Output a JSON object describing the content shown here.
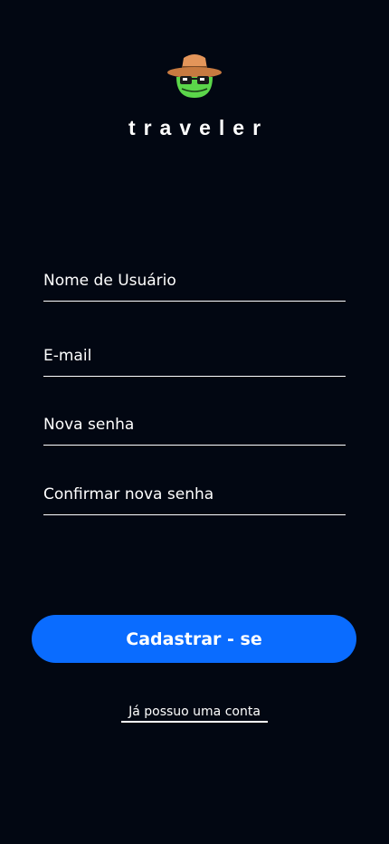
{
  "app": {
    "brand_name": "traveler",
    "logo_icon": "frog-with-hat-icon"
  },
  "form": {
    "username_placeholder": "Nome de Usuário",
    "email_placeholder": "E-mail",
    "new_password_placeholder": "Nova senha",
    "confirm_password_placeholder": "Confirmar nova senha",
    "username_value": "",
    "email_value": "",
    "new_password_value": "",
    "confirm_password_value": ""
  },
  "actions": {
    "register_label": "Cadastrar - se",
    "existing_account_label": "Já possuo uma conta"
  },
  "colors": {
    "background": "#020712",
    "accent": "#0a6cff",
    "text": "#ffffff"
  }
}
